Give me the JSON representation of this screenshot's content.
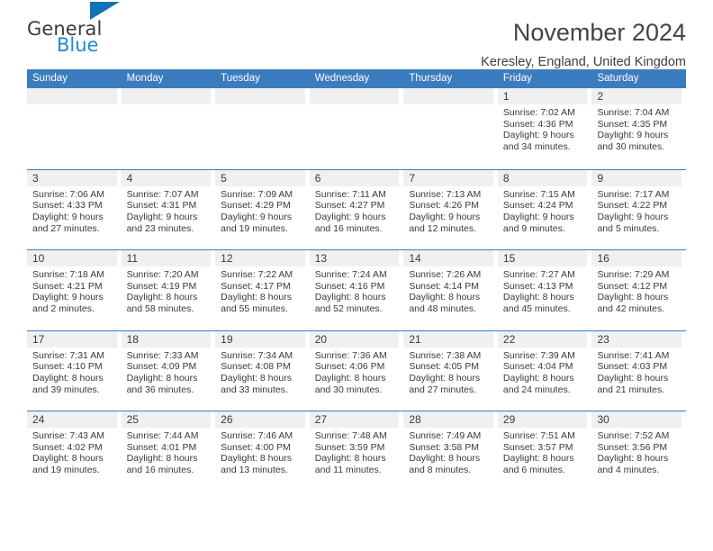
{
  "logo": {
    "line1": "General",
    "line2": "Blue",
    "triangle_color": "#1272b8",
    "blue_text_color": "#1f8ad4"
  },
  "header": {
    "title": "November 2024",
    "subtitle": "Keresley, England, United Kingdom"
  },
  "calendar": {
    "header_bg": "#3b7cbf",
    "day_band_bg": "#f0f0f0",
    "weekdays": [
      "Sunday",
      "Monday",
      "Tuesday",
      "Wednesday",
      "Thursday",
      "Friday",
      "Saturday"
    ],
    "weeks": [
      [
        {
          "day": "",
          "empty": true
        },
        {
          "day": "",
          "empty": true
        },
        {
          "day": "",
          "empty": true
        },
        {
          "day": "",
          "empty": true
        },
        {
          "day": "",
          "empty": true
        },
        {
          "day": "1",
          "sunrise": "Sunrise: 7:02 AM",
          "sunset": "Sunset: 4:36 PM",
          "daylight1": "Daylight: 9 hours",
          "daylight2": "and 34 minutes."
        },
        {
          "day": "2",
          "sunrise": "Sunrise: 7:04 AM",
          "sunset": "Sunset: 4:35 PM",
          "daylight1": "Daylight: 9 hours",
          "daylight2": "and 30 minutes."
        }
      ],
      [
        {
          "day": "3",
          "sunrise": "Sunrise: 7:06 AM",
          "sunset": "Sunset: 4:33 PM",
          "daylight1": "Daylight: 9 hours",
          "daylight2": "and 27 minutes."
        },
        {
          "day": "4",
          "sunrise": "Sunrise: 7:07 AM",
          "sunset": "Sunset: 4:31 PM",
          "daylight1": "Daylight: 9 hours",
          "daylight2": "and 23 minutes."
        },
        {
          "day": "5",
          "sunrise": "Sunrise: 7:09 AM",
          "sunset": "Sunset: 4:29 PM",
          "daylight1": "Daylight: 9 hours",
          "daylight2": "and 19 minutes."
        },
        {
          "day": "6",
          "sunrise": "Sunrise: 7:11 AM",
          "sunset": "Sunset: 4:27 PM",
          "daylight1": "Daylight: 9 hours",
          "daylight2": "and 16 minutes."
        },
        {
          "day": "7",
          "sunrise": "Sunrise: 7:13 AM",
          "sunset": "Sunset: 4:26 PM",
          "daylight1": "Daylight: 9 hours",
          "daylight2": "and 12 minutes."
        },
        {
          "day": "8",
          "sunrise": "Sunrise: 7:15 AM",
          "sunset": "Sunset: 4:24 PM",
          "daylight1": "Daylight: 9 hours",
          "daylight2": "and 9 minutes."
        },
        {
          "day": "9",
          "sunrise": "Sunrise: 7:17 AM",
          "sunset": "Sunset: 4:22 PM",
          "daylight1": "Daylight: 9 hours",
          "daylight2": "and 5 minutes."
        }
      ],
      [
        {
          "day": "10",
          "sunrise": "Sunrise: 7:18 AM",
          "sunset": "Sunset: 4:21 PM",
          "daylight1": "Daylight: 9 hours",
          "daylight2": "and 2 minutes."
        },
        {
          "day": "11",
          "sunrise": "Sunrise: 7:20 AM",
          "sunset": "Sunset: 4:19 PM",
          "daylight1": "Daylight: 8 hours",
          "daylight2": "and 58 minutes."
        },
        {
          "day": "12",
          "sunrise": "Sunrise: 7:22 AM",
          "sunset": "Sunset: 4:17 PM",
          "daylight1": "Daylight: 8 hours",
          "daylight2": "and 55 minutes."
        },
        {
          "day": "13",
          "sunrise": "Sunrise: 7:24 AM",
          "sunset": "Sunset: 4:16 PM",
          "daylight1": "Daylight: 8 hours",
          "daylight2": "and 52 minutes."
        },
        {
          "day": "14",
          "sunrise": "Sunrise: 7:26 AM",
          "sunset": "Sunset: 4:14 PM",
          "daylight1": "Daylight: 8 hours",
          "daylight2": "and 48 minutes."
        },
        {
          "day": "15",
          "sunrise": "Sunrise: 7:27 AM",
          "sunset": "Sunset: 4:13 PM",
          "daylight1": "Daylight: 8 hours",
          "daylight2": "and 45 minutes."
        },
        {
          "day": "16",
          "sunrise": "Sunrise: 7:29 AM",
          "sunset": "Sunset: 4:12 PM",
          "daylight1": "Daylight: 8 hours",
          "daylight2": "and 42 minutes."
        }
      ],
      [
        {
          "day": "17",
          "sunrise": "Sunrise: 7:31 AM",
          "sunset": "Sunset: 4:10 PM",
          "daylight1": "Daylight: 8 hours",
          "daylight2": "and 39 minutes."
        },
        {
          "day": "18",
          "sunrise": "Sunrise: 7:33 AM",
          "sunset": "Sunset: 4:09 PM",
          "daylight1": "Daylight: 8 hours",
          "daylight2": "and 36 minutes."
        },
        {
          "day": "19",
          "sunrise": "Sunrise: 7:34 AM",
          "sunset": "Sunset: 4:08 PM",
          "daylight1": "Daylight: 8 hours",
          "daylight2": "and 33 minutes."
        },
        {
          "day": "20",
          "sunrise": "Sunrise: 7:36 AM",
          "sunset": "Sunset: 4:06 PM",
          "daylight1": "Daylight: 8 hours",
          "daylight2": "and 30 minutes."
        },
        {
          "day": "21",
          "sunrise": "Sunrise: 7:38 AM",
          "sunset": "Sunset: 4:05 PM",
          "daylight1": "Daylight: 8 hours",
          "daylight2": "and 27 minutes."
        },
        {
          "day": "22",
          "sunrise": "Sunrise: 7:39 AM",
          "sunset": "Sunset: 4:04 PM",
          "daylight1": "Daylight: 8 hours",
          "daylight2": "and 24 minutes."
        },
        {
          "day": "23",
          "sunrise": "Sunrise: 7:41 AM",
          "sunset": "Sunset: 4:03 PM",
          "daylight1": "Daylight: 8 hours",
          "daylight2": "and 21 minutes."
        }
      ],
      [
        {
          "day": "24",
          "sunrise": "Sunrise: 7:43 AM",
          "sunset": "Sunset: 4:02 PM",
          "daylight1": "Daylight: 8 hours",
          "daylight2": "and 19 minutes."
        },
        {
          "day": "25",
          "sunrise": "Sunrise: 7:44 AM",
          "sunset": "Sunset: 4:01 PM",
          "daylight1": "Daylight: 8 hours",
          "daylight2": "and 16 minutes."
        },
        {
          "day": "26",
          "sunrise": "Sunrise: 7:46 AM",
          "sunset": "Sunset: 4:00 PM",
          "daylight1": "Daylight: 8 hours",
          "daylight2": "and 13 minutes."
        },
        {
          "day": "27",
          "sunrise": "Sunrise: 7:48 AM",
          "sunset": "Sunset: 3:59 PM",
          "daylight1": "Daylight: 8 hours",
          "daylight2": "and 11 minutes."
        },
        {
          "day": "28",
          "sunrise": "Sunrise: 7:49 AM",
          "sunset": "Sunset: 3:58 PM",
          "daylight1": "Daylight: 8 hours",
          "daylight2": "and 8 minutes."
        },
        {
          "day": "29",
          "sunrise": "Sunrise: 7:51 AM",
          "sunset": "Sunset: 3:57 PM",
          "daylight1": "Daylight: 8 hours",
          "daylight2": "and 6 minutes."
        },
        {
          "day": "30",
          "sunrise": "Sunrise: 7:52 AM",
          "sunset": "Sunset: 3:56 PM",
          "daylight1": "Daylight: 8 hours",
          "daylight2": "and 4 minutes."
        }
      ]
    ]
  }
}
